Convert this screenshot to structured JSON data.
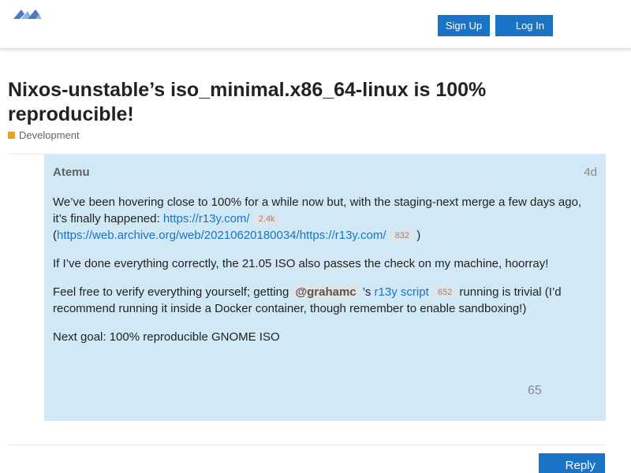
{
  "header": {
    "signup_label": "Sign Up",
    "login_label": "Log In",
    "brand_color": "#1a73c4"
  },
  "topic": {
    "title": "Nixos-unstable’s iso_minimal.x86_64-linux is 100% reproducible!",
    "category": "Development",
    "category_color": "#f0a020"
  },
  "post": {
    "author": "Atemu",
    "date": "4d",
    "p1_text": "We’ve been hovering close to 100% for a while now but, with the staging-next merge a few days ago, it’s finally happened: ",
    "p1_link1": "https://r13y.com/",
    "p1_link1_clicks": "2.4k",
    "p1_open_paren": "(",
    "p1_link2": "https://web.archive.org/web/20210620180034/https://r13y.com/",
    "p1_link2_clicks": "832",
    "p1_close_paren": ")",
    "p2": "If I’ve done everything correctly, the 21.05 ISO also passes the check on my machine, hoorray!",
    "p3_text_a": "Feel free to verify everything yourself; getting ",
    "p3_mention": "@grahamc",
    "p3_text_b": " ’s ",
    "p3_link": "r13y script",
    "p3_link_clicks": "652",
    "p3_text_c": " running is trivial (I’d recommend running it inside a Docker container, though remember to enable sandboxing!)",
    "p4": "Next goal: 100% reproducible GNOME ISO",
    "likes": "65",
    "background_color": "#d1e9f7"
  },
  "footer": {
    "reply_label": "Reply"
  }
}
